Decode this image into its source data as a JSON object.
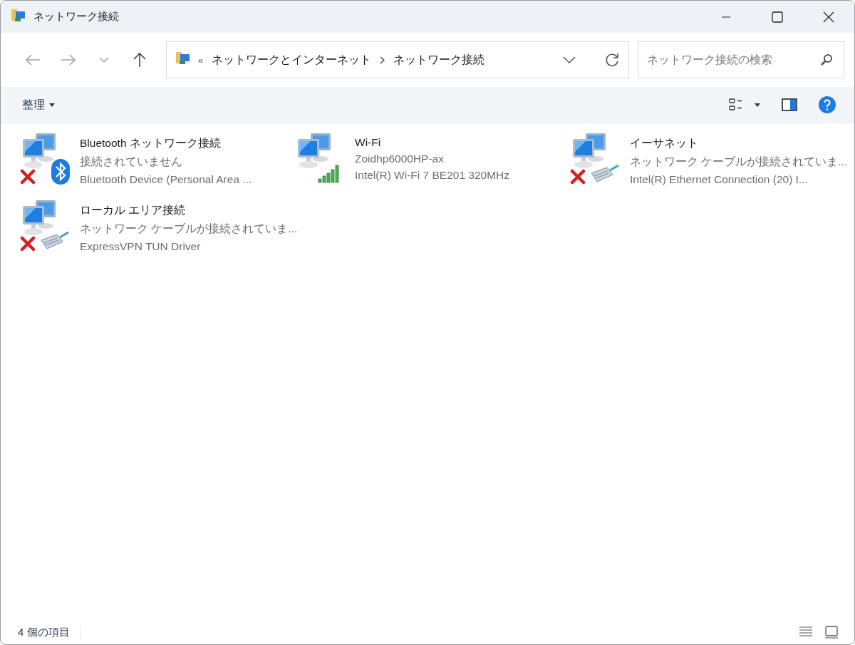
{
  "window": {
    "title": "ネットワーク接続"
  },
  "address_bar": {
    "overflow": "«",
    "path": [
      {
        "label": "ネットワークとインターネット"
      },
      {
        "label": "ネットワーク接続"
      }
    ]
  },
  "search": {
    "placeholder": "ネットワーク接続の検索"
  },
  "toolbar": {
    "organize": "整理"
  },
  "connections": [
    {
      "name": "Bluetooth ネットワーク接続",
      "status": "接続されていません",
      "device": "Bluetooth Device (Personal Area ...",
      "kind": "bluetooth",
      "disconnected": true
    },
    {
      "name": "Wi-Fi",
      "status": "Zoidhp6000HP-ax",
      "device": "Intel(R) Wi-Fi 7 BE201 320MHz",
      "kind": "wifi",
      "disconnected": false
    },
    {
      "name": "イーサネット",
      "status": "ネットワーク ケーブルが接続されていま...",
      "device": "Intel(R) Ethernet Connection (20) I...",
      "kind": "ethernet",
      "disconnected": true
    },
    {
      "name": "ローカル エリア接続",
      "status": "ネットワーク ケーブルが接続されていま...",
      "device": "ExpressVPN TUN Driver",
      "kind": "ethernet",
      "disconnected": true
    }
  ],
  "status_bar": {
    "item_count": "4 個の項目"
  }
}
